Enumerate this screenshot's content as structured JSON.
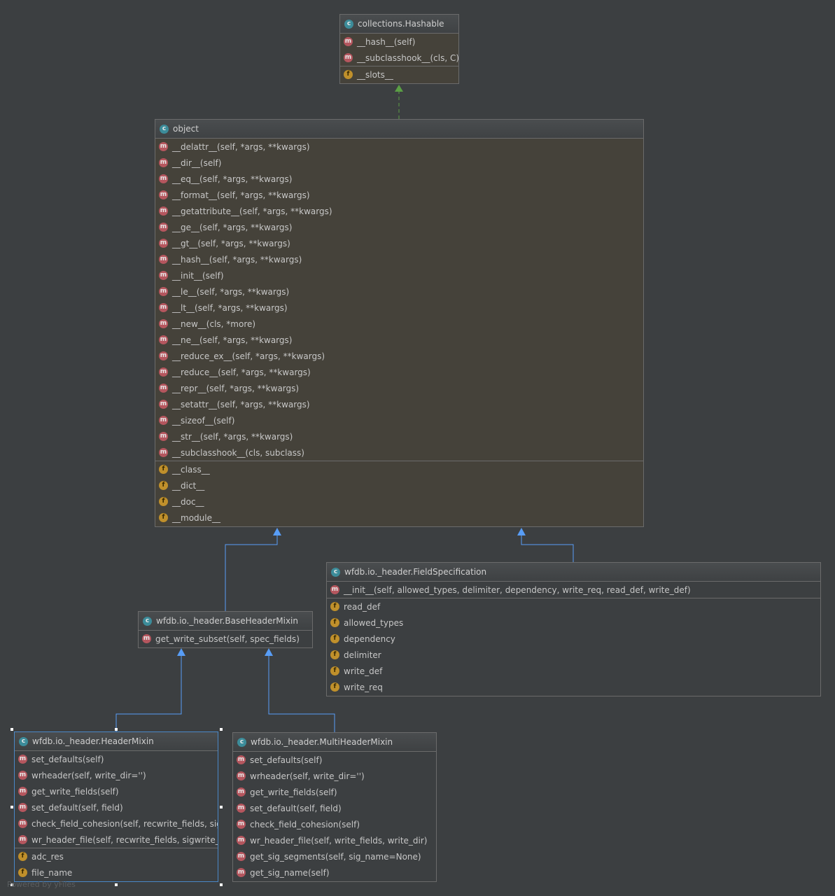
{
  "classes": {
    "hashable": {
      "name": "collections.Hashable",
      "methods": [
        "__hash__(self)",
        "__subclasshook__(cls, C)"
      ],
      "fields": [
        "__slots__"
      ]
    },
    "object": {
      "name": "object",
      "methods": [
        "__delattr__(self, *args, **kwargs)",
        "__dir__(self)",
        "__eq__(self, *args, **kwargs)",
        "__format__(self, *args, **kwargs)",
        "__getattribute__(self, *args, **kwargs)",
        "__ge__(self, *args, **kwargs)",
        "__gt__(self, *args, **kwargs)",
        "__hash__(self, *args, **kwargs)",
        "__init__(self)",
        "__le__(self, *args, **kwargs)",
        "__lt__(self, *args, **kwargs)",
        "__new__(cls, *more)",
        "__ne__(self, *args, **kwargs)",
        "__reduce_ex__(self, *args, **kwargs)",
        "__reduce__(self, *args, **kwargs)",
        "__repr__(self, *args, **kwargs)",
        "__setattr__(self, *args, **kwargs)",
        "__sizeof__(self)",
        "__str__(self, *args, **kwargs)",
        "__subclasshook__(cls, subclass)"
      ],
      "fields": [
        "__class__",
        "__dict__",
        "__doc__",
        "__module__"
      ]
    },
    "field_spec": {
      "name": "wfdb.io._header.FieldSpecification",
      "methods": [
        "__init__(self, allowed_types, delimiter, dependency, write_req,                    read_def, write_def)"
      ],
      "fields": [
        "read_def",
        "allowed_types",
        "dependency",
        "delimiter",
        "write_def",
        "write_req"
      ]
    },
    "base_header_mixin": {
      "name": "wfdb.io._header.BaseHeaderMixin",
      "methods": [
        "get_write_subset(self, spec_fields)"
      ],
      "fields": []
    },
    "header_mixin": {
      "name": "wfdb.io._header.HeaderMixin",
      "methods": [
        "set_defaults(self)",
        "wrheader(self, write_dir='')",
        "get_write_fields(self)",
        "set_default(self, field)",
        "check_field_cohesion(self, recwrite_fields, sigwrite_fields)",
        "wr_header_file(self, recwrite_fields, sigwrite_fields, write_dir)"
      ],
      "fields": [
        "adc_res",
        "file_name"
      ]
    },
    "multi_header_mixin": {
      "name": "wfdb.io._header.MultiHeaderMixin",
      "methods": [
        "set_defaults(self)",
        "wrheader(self, write_dir='')",
        "get_write_fields(self)",
        "set_default(self, field)",
        "check_field_cohesion(self)",
        "wr_header_file(self, write_fields, write_dir)",
        "get_sig_segments(self, sig_name=None)",
        "get_sig_name(self)"
      ],
      "fields": []
    }
  },
  "icons": {
    "class": "c",
    "method": "m",
    "field": "f"
  },
  "colors": {
    "inherit_arrow": "#589df6",
    "implement_arrow": "#5b9f45",
    "class_icon": "#3c8c9a",
    "method_icon": "#b5565e",
    "field_icon": "#c0902b"
  },
  "watermark": "Powered by yFiles"
}
